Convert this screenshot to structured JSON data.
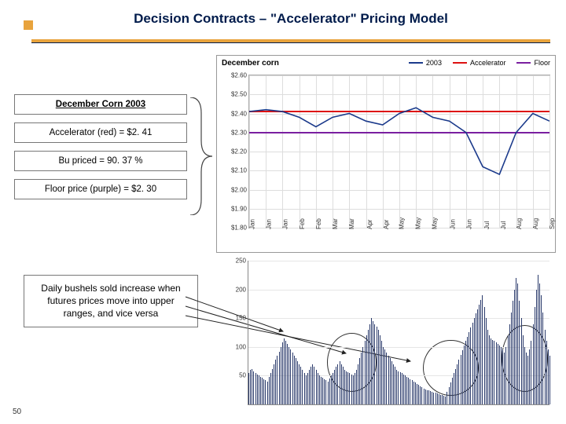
{
  "title": "Decision Contracts – \"Accelerator\" Pricing Model",
  "page_number": "50",
  "callouts": {
    "heading": "December Corn 2003",
    "accel": "Accelerator (red) = $2. 41",
    "bu": "Bu priced = 90. 37 %",
    "floor": "Floor price (purple) = $2. 30"
  },
  "callout_bottom": "Daily bushels sold increase when futures prices move into upper ranges, and vice versa",
  "chart_data": [
    {
      "type": "line",
      "title": "December corn",
      "xlabel": "",
      "ylabel": "",
      "ylim": [
        1.8,
        2.6
      ],
      "yticks": [
        "$1.80",
        "$1.90",
        "$2.00",
        "$2.10",
        "$2.20",
        "$2.30",
        "$2.40",
        "$2.50",
        "$2.60"
      ],
      "xcats": [
        "Jan",
        "Jan",
        "Jan",
        "Feb",
        "Feb",
        "Mar",
        "Mar",
        "Apr",
        "Apr",
        "May",
        "May",
        "May",
        "Jun",
        "Jun",
        "Jul",
        "Jul",
        "Aug",
        "Aug",
        "Sep"
      ],
      "series": [
        {
          "name": "2003",
          "color": "#1b3a8b",
          "values": [
            2.41,
            2.42,
            2.41,
            2.38,
            2.33,
            2.38,
            2.4,
            2.36,
            2.34,
            2.4,
            2.43,
            2.38,
            2.36,
            2.3,
            2.12,
            2.08,
            2.3,
            2.4,
            2.36
          ]
        },
        {
          "name": "Accelerator",
          "color": "#d11",
          "const": 2.41
        },
        {
          "name": "Floor",
          "color": "#7a1fa0",
          "const": 2.3
        }
      ]
    },
    {
      "type": "bar",
      "title": "",
      "ylim": [
        0,
        250
      ],
      "yticks": [
        "50",
        "100",
        "150",
        "200",
        "250"
      ],
      "x_count": 180,
      "values": [
        55,
        60,
        62,
        58,
        55,
        52,
        50,
        48,
        46,
        44,
        42,
        40,
        48,
        55,
        62,
        70,
        78,
        85,
        92,
        100,
        108,
        115,
        110,
        105,
        100,
        95,
        90,
        85,
        80,
        75,
        70,
        65,
        60,
        55,
        50,
        55,
        60,
        65,
        70,
        65,
        60,
        55,
        50,
        48,
        46,
        44,
        42,
        40,
        45,
        50,
        55,
        60,
        65,
        70,
        75,
        70,
        65,
        60,
        58,
        56,
        54,
        52,
        50,
        55,
        60,
        70,
        80,
        90,
        100,
        110,
        120,
        130,
        140,
        150,
        145,
        140,
        135,
        130,
        120,
        110,
        100,
        95,
        90,
        85,
        80,
        75,
        70,
        65,
        60,
        58,
        56,
        54,
        52,
        50,
        48,
        46,
        44,
        42,
        40,
        38,
        36,
        34,
        32,
        30,
        28,
        26,
        25,
        24,
        23,
        22,
        21,
        20,
        19,
        18,
        17,
        16,
        15,
        14,
        22,
        30,
        38,
        46,
        54,
        62,
        70,
        78,
        86,
        94,
        102,
        110,
        118,
        126,
        134,
        142,
        150,
        158,
        166,
        174,
        182,
        190,
        170,
        150,
        130,
        120,
        115,
        112,
        110,
        108,
        105,
        102,
        100,
        95,
        90,
        100,
        120,
        140,
        160,
        180,
        200,
        220,
        210,
        180,
        150,
        120,
        100,
        90,
        85,
        95,
        110,
        140,
        170,
        200,
        225,
        210,
        190,
        160,
        130,
        110,
        95,
        85
      ]
    }
  ],
  "legend": {
    "s1": "2003",
    "s2": "Accelerator",
    "s3": "Floor"
  },
  "colors": {
    "s1": "#1b3a8b",
    "s2": "#d11",
    "s3": "#7a1fa0"
  }
}
